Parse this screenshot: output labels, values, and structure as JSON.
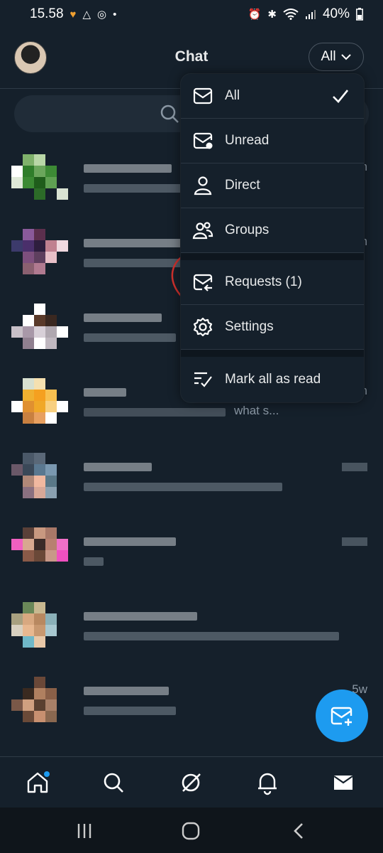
{
  "status_bar": {
    "time": "15.58",
    "battery": "40%",
    "left_icons": [
      "heart-badge-icon",
      "drive-icon",
      "sync-icon",
      "dot-icon"
    ],
    "right_icons": [
      "alarm-icon",
      "bluetooth-icon",
      "wifi-icon",
      "signal-icon",
      "battery-icon"
    ]
  },
  "header": {
    "title": "Chat",
    "filter_label": "All"
  },
  "search": {
    "icon": "search-icon"
  },
  "conversations": [
    {
      "preview_tail": "",
      "time": "m"
    },
    {
      "preview_tail": "",
      "time": "m"
    },
    {
      "preview_tail": "",
      "time": ""
    },
    {
      "preview_tail": "what s...",
      "time": "n"
    },
    {
      "preview_tail": "",
      "time": ""
    },
    {
      "preview_tail": "",
      "time": ""
    },
    {
      "preview_tail": "",
      "time": ""
    },
    {
      "preview_tail": "",
      "time": "5w"
    }
  ],
  "menu": {
    "items": [
      {
        "label": "All",
        "icon": "inbox-icon",
        "selected": true
      },
      {
        "label": "Unread",
        "icon": "unread-envelope-icon"
      },
      {
        "label": "Direct",
        "icon": "person-icon"
      },
      {
        "label": "Groups",
        "icon": "people-icon"
      },
      {
        "label": "Requests (1)",
        "icon": "request-envelope-icon"
      },
      {
        "label": "Settings",
        "icon": "gear-icon"
      },
      {
        "label": "Mark all as read",
        "icon": "mark-read-icon"
      }
    ]
  },
  "fab": {
    "icon": "new-message-icon"
  },
  "tab_bar": {
    "tabs": [
      "home-icon",
      "search-icon",
      "grok-icon",
      "bell-icon",
      "mail-icon"
    ]
  },
  "nav_bar": {
    "buttons": [
      "recents-icon",
      "home-circle-icon",
      "back-icon"
    ]
  },
  "colors": {
    "background": "#15202b",
    "accent": "#1d9bf0",
    "annotation": "#d0312d"
  }
}
